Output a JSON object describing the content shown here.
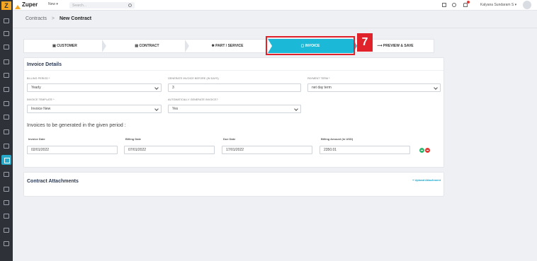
{
  "topbar": {
    "brand": "Zuper",
    "new_label": "New",
    "search_placeholder": "Search...",
    "user_name": "Kalyana Sundaram S"
  },
  "breadcrumb": {
    "parent": "Contracts",
    "separator": ">",
    "current": "New Contract"
  },
  "stepper": {
    "steps": [
      {
        "label": "CUSTOMER"
      },
      {
        "label": "CONTRACT"
      },
      {
        "label": "PART / SERVICE"
      },
      {
        "label": "INVOICE"
      },
      {
        "label": "PREVIEW & SAVE"
      }
    ],
    "active_index": 3,
    "callout_number": "7"
  },
  "invoice": {
    "title": "Invoice Details",
    "billing_period_label": "BILLING PERIOD *",
    "billing_period_value": "Yearly",
    "generate_before_label": "GENERATE INVOICE BEFORE (IN DAYS)",
    "generate_before_value": "3",
    "payment_term_label": "PAYMENT TERM *",
    "payment_term_value": "net day term",
    "template_label": "INVOICE TEMPLATE *",
    "template_value": "Invoice New",
    "auto_generate_label": "AUTOMATICALLY GENERATE INVOICE?",
    "auto_generate_value": "Yes",
    "generated_title": "Invoices to be generated in the given period :",
    "table_headers": [
      "Invoice Date",
      "Billing Date",
      "Due Date",
      "Billing Amount (in USD)"
    ],
    "row": [
      "02/01/2022",
      "07/01/2022",
      "17/01/2022",
      "2350.01"
    ]
  },
  "attachments": {
    "title": "Contract Attachments",
    "upload_label": "+ Upload Attachment"
  },
  "colors": {
    "accent": "#16b7d6",
    "highlight": "#e0222b",
    "rail": "#2f3138"
  }
}
